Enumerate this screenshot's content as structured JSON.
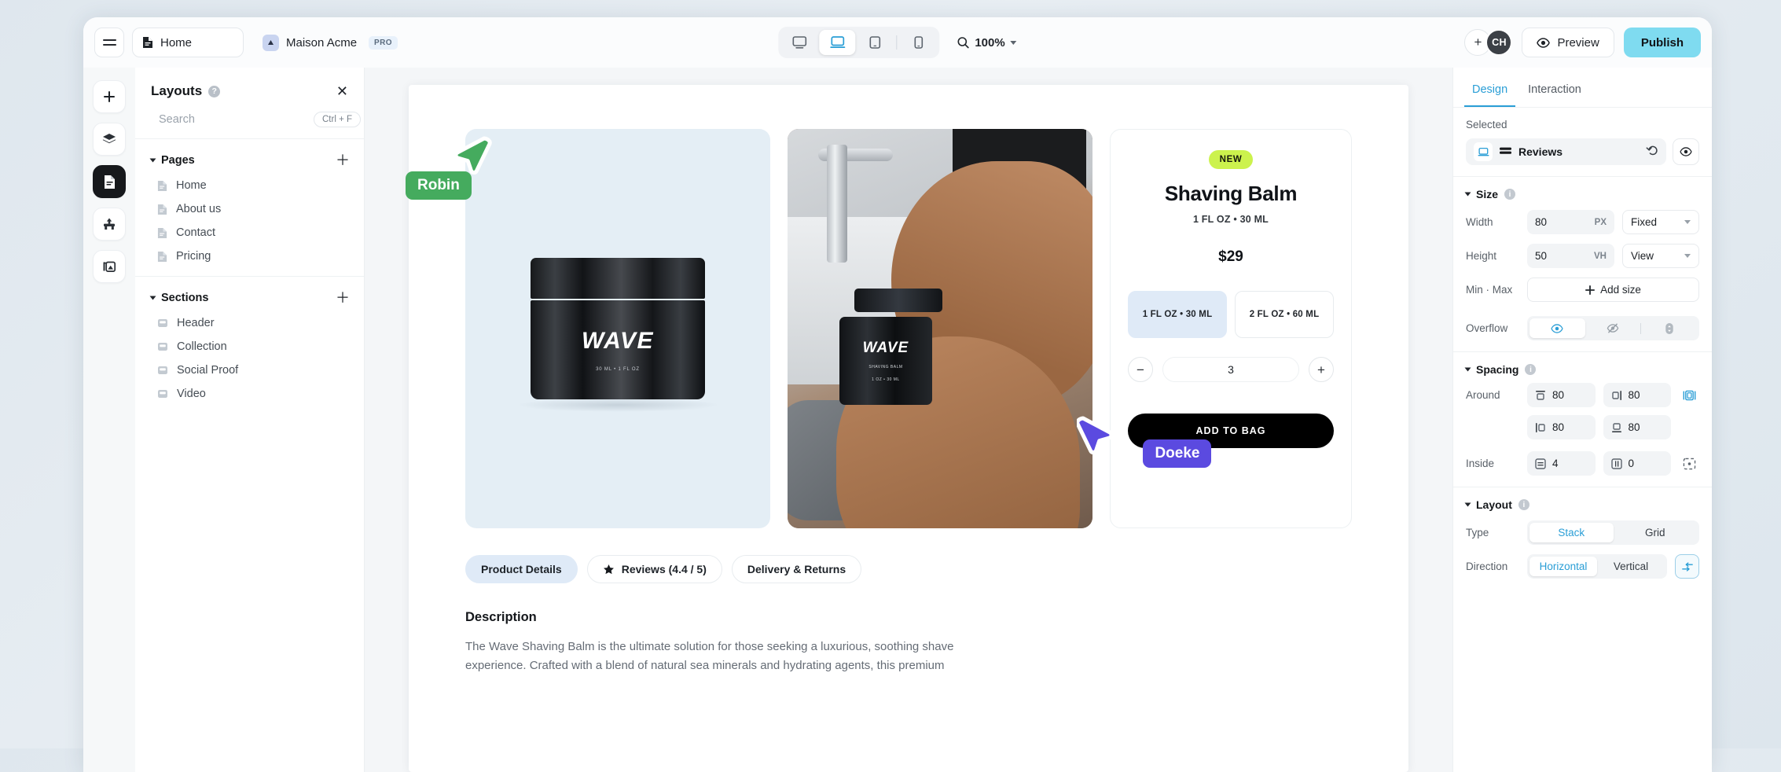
{
  "topbar": {
    "menu_icon": "hamburger-icon",
    "page_button": {
      "label": "Home",
      "icon": "page-icon"
    },
    "project": {
      "name": "Maison Acme",
      "badge": "PRO",
      "icon": "project-icon"
    },
    "devices": [
      {
        "name": "desktop",
        "active": false
      },
      {
        "name": "laptop",
        "active": true
      },
      {
        "name": "tablet",
        "active": false
      },
      {
        "name": "mobile",
        "active": false
      }
    ],
    "zoom": {
      "value": "100%",
      "icon": "search-icon"
    },
    "add_user": "+",
    "avatar": "CH",
    "preview": {
      "label": "Preview",
      "icon": "eye-icon"
    },
    "publish": {
      "label": "Publish",
      "color": "#7fdbf0"
    }
  },
  "rail": [
    {
      "name": "add",
      "icon": "plus-icon",
      "active": false
    },
    {
      "name": "layers",
      "icon": "layers-icon",
      "active": false
    },
    {
      "name": "pages",
      "icon": "page-icon",
      "active": true
    },
    {
      "name": "design",
      "icon": "brush-icon",
      "active": false
    },
    {
      "name": "assets",
      "icon": "images-icon",
      "active": false
    }
  ],
  "panel": {
    "title": "Layouts",
    "help_icon": "question-icon",
    "close_icon": "close-icon",
    "search": {
      "placeholder": "Search",
      "value": "",
      "shortcut": "Ctrl + F",
      "icon": "search-icon"
    },
    "groups": [
      {
        "label": "Pages",
        "add_icon": "plus-icon",
        "items": [
          {
            "label": "Home",
            "icon": "page-icon"
          },
          {
            "label": "About us",
            "icon": "page-icon"
          },
          {
            "label": "Contact",
            "icon": "page-icon"
          },
          {
            "label": "Pricing",
            "icon": "page-icon"
          }
        ]
      },
      {
        "label": "Sections",
        "add_icon": "plus-icon",
        "items": [
          {
            "label": "Header",
            "icon": "section-icon"
          },
          {
            "label": "Collection",
            "icon": "section-icon"
          },
          {
            "label": "Social Proof",
            "icon": "section-icon"
          },
          {
            "label": "Video",
            "icon": "section-icon"
          }
        ]
      }
    ]
  },
  "canvas": {
    "images": [
      {
        "name": "product-jar-studio",
        "logo": "WAVE",
        "sub": "30 ML • 1 FL OZ"
      },
      {
        "name": "product-in-hands",
        "logo": "WAVE",
        "sub_line1": "SHAVING BALM",
        "sub_line2": "1 OZ • 30 ML"
      }
    ],
    "product": {
      "badge": "NEW",
      "title": "Shaving Balm",
      "size": "1 FL OZ • 30 ML",
      "price": "$29",
      "variants": [
        {
          "label": "1 FL OZ • 30 ML",
          "selected": true
        },
        {
          "label": "2 FL OZ • 60 ML",
          "selected": false
        }
      ],
      "quantity": "3",
      "minus": "−",
      "plus": "+",
      "add_to_bag": "ADD TO BAG"
    },
    "tabs": [
      {
        "label": "Product Details",
        "active": true,
        "icon": null
      },
      {
        "label": "Reviews (4.4 / 5)",
        "active": false,
        "icon": "star-icon"
      },
      {
        "label": "Delivery & Returns",
        "active": false,
        "icon": null
      }
    ],
    "description": {
      "title": "Description",
      "body": "The Wave Shaving Balm is the ultimate solution for those seeking a luxurious, soothing shave experience. Crafted with a blend of natural sea minerals and hydrating agents, this premium"
    },
    "cursors": [
      {
        "name": "Robin",
        "color": "#45ab5e"
      },
      {
        "name": "Doeke",
        "color": "#5b4ae0"
      }
    ]
  },
  "inspector": {
    "tabs": [
      {
        "label": "Design",
        "active": true
      },
      {
        "label": "Interaction",
        "active": false
      }
    ],
    "selected": {
      "label": "Selected",
      "device_icon": "laptop-icon",
      "element_icon": "section-icon",
      "name": "Reviews",
      "reset_icon": "reset-icon",
      "eye_icon": "eye-icon"
    },
    "size": {
      "title": "Size",
      "info_icon": "info-icon",
      "width": {
        "label": "Width",
        "value": "80",
        "unit": "PX",
        "mode": "Fixed"
      },
      "height": {
        "label": "Height",
        "value": "50",
        "unit": "VH",
        "mode": "View"
      },
      "minmax": {
        "label": "Min · Max",
        "button": "Add size",
        "icon": "plus-icon"
      },
      "overflow": {
        "label": "Overflow",
        "options": [
          {
            "name": "visible",
            "icon": "eye-icon",
            "active": true
          },
          {
            "name": "hidden",
            "icon": "eye-off-icon",
            "active": false
          },
          {
            "name": "scroll",
            "icon": "scroll-icon",
            "active": false
          }
        ]
      }
    },
    "spacing": {
      "title": "Spacing",
      "info_icon": "info-icon",
      "around": {
        "label": "Around",
        "top": "80",
        "right": "80",
        "left": "80",
        "bottom": "80",
        "link_icon": "link-spacing-icon"
      },
      "inside": {
        "label": "Inside",
        "vertical": "4",
        "horizontal": "0",
        "link_icon": "inside-link-icon"
      }
    },
    "layout": {
      "title": "Layout",
      "info_icon": "info-icon",
      "type": {
        "label": "Type",
        "options": [
          "Stack",
          "Grid"
        ],
        "active": "Stack"
      },
      "direction": {
        "label": "Direction",
        "options": [
          "Horizontal",
          "Vertical"
        ],
        "active": "Horizontal",
        "extra_icon": "align-icon"
      }
    }
  }
}
